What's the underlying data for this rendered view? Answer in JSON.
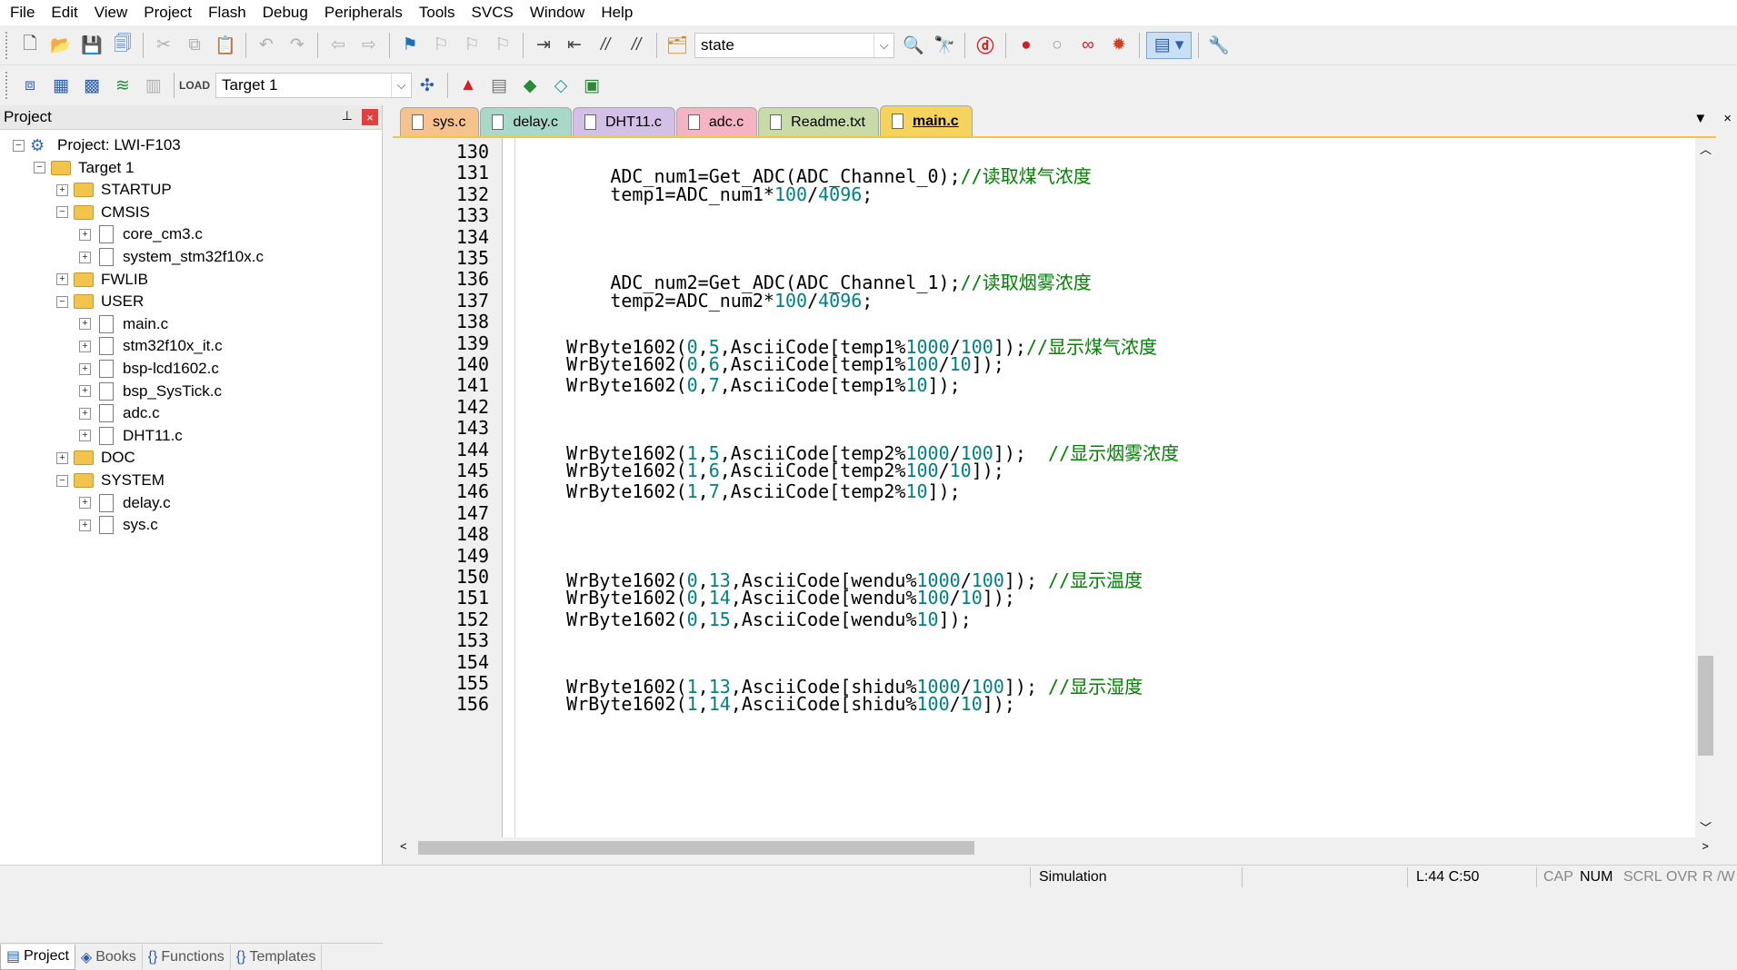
{
  "menu": [
    "File",
    "Edit",
    "View",
    "Project",
    "Flash",
    "Debug",
    "Peripherals",
    "Tools",
    "SVCS",
    "Window",
    "Help"
  ],
  "toolbar": {
    "find_value": "state",
    "target_value": "Target 1"
  },
  "project_panel": {
    "title": "Project",
    "pin": "⊥",
    "close": "×",
    "tree": [
      {
        "label": "Project: LWI-F103",
        "level": 0,
        "kind": "project",
        "expand": "−"
      },
      {
        "label": "Target 1",
        "level": 1,
        "kind": "target",
        "expand": "−"
      },
      {
        "label": "STARTUP",
        "level": 2,
        "kind": "folder",
        "expand": "+"
      },
      {
        "label": "CMSIS",
        "level": 2,
        "kind": "folder",
        "expand": "−"
      },
      {
        "label": "core_cm3.c",
        "level": 3,
        "kind": "file",
        "expand": "+"
      },
      {
        "label": "system_stm32f10x.c",
        "level": 3,
        "kind": "file",
        "expand": "+"
      },
      {
        "label": "FWLIB",
        "level": 2,
        "kind": "folder",
        "expand": "+"
      },
      {
        "label": "USER",
        "level": 2,
        "kind": "folder",
        "expand": "−"
      },
      {
        "label": "main.c",
        "level": 3,
        "kind": "file",
        "expand": "+"
      },
      {
        "label": "stm32f10x_it.c",
        "level": 3,
        "kind": "file",
        "expand": "+"
      },
      {
        "label": "bsp-lcd1602.c",
        "level": 3,
        "kind": "file",
        "expand": "+"
      },
      {
        "label": "bsp_SysTick.c",
        "level": 3,
        "kind": "file",
        "expand": "+"
      },
      {
        "label": "adc.c",
        "level": 3,
        "kind": "file",
        "expand": "+"
      },
      {
        "label": "DHT11.c",
        "level": 3,
        "kind": "file",
        "expand": "+"
      },
      {
        "label": "DOC",
        "level": 2,
        "kind": "folder",
        "expand": "+"
      },
      {
        "label": "SYSTEM",
        "level": 2,
        "kind": "folder",
        "expand": "−"
      },
      {
        "label": "delay.c",
        "level": 3,
        "kind": "file",
        "expand": "+"
      },
      {
        "label": "sys.c",
        "level": 3,
        "kind": "file",
        "expand": "+"
      }
    ],
    "tabs": [
      "Project",
      "Books",
      "Functions",
      "Templates"
    ],
    "tab_icons": [
      "▤",
      "◈",
      "{}",
      "{}"
    ]
  },
  "file_tabs": [
    {
      "label": "sys.c",
      "color": "#f6c28e"
    },
    {
      "label": "delay.c",
      "color": "#a8d8c8"
    },
    {
      "label": "DHT11.c",
      "color": "#d4bfe6"
    },
    {
      "label": "adc.c",
      "color": "#f4b4c4"
    },
    {
      "label": "Readme.txt",
      "color": "#c8dcaa"
    },
    {
      "label": "main.c",
      "color": "#f5d35e",
      "active": true
    }
  ],
  "tab_controls": {
    "menu": "▼",
    "close": "×"
  },
  "code": [
    {
      "ln": "130",
      "text": []
    },
    {
      "ln": "131",
      "text": [
        [
          "        ADC_num1=Get_ADC(ADC_Channel_0);",
          ""
        ],
        [
          "//读取煤气浓度",
          "c"
        ]
      ]
    },
    {
      "ln": "132",
      "text": [
        [
          "        temp1=ADC_num1*",
          ""
        ],
        [
          "100",
          "n"
        ],
        [
          "/",
          ""
        ],
        [
          "4096",
          "n"
        ],
        [
          ";",
          ""
        ]
      ]
    },
    {
      "ln": "133",
      "text": []
    },
    {
      "ln": "134",
      "text": []
    },
    {
      "ln": "135",
      "text": []
    },
    {
      "ln": "136",
      "text": [
        [
          "        ADC_num2=Get_ADC(ADC_Channel_1);",
          ""
        ],
        [
          "//读取烟雾浓度",
          "c"
        ]
      ]
    },
    {
      "ln": "137",
      "text": [
        [
          "        temp2=ADC_num2*",
          ""
        ],
        [
          "100",
          "n"
        ],
        [
          "/",
          ""
        ],
        [
          "4096",
          "n"
        ],
        [
          ";",
          ""
        ]
      ]
    },
    {
      "ln": "138",
      "text": []
    },
    {
      "ln": "139",
      "text": [
        [
          "    WrByte1602(",
          ""
        ],
        [
          "0",
          "n"
        ],
        [
          ",",
          ""
        ],
        [
          "5",
          "n"
        ],
        [
          ",AsciiCode[temp1%",
          ""
        ],
        [
          "1000",
          "n"
        ],
        [
          "/",
          ""
        ],
        [
          "100",
          "n"
        ],
        [
          "]);",
          ""
        ],
        [
          "//显示煤气浓度",
          "c"
        ]
      ]
    },
    {
      "ln": "140",
      "text": [
        [
          "    WrByte1602(",
          ""
        ],
        [
          "0",
          "n"
        ],
        [
          ",",
          ""
        ],
        [
          "6",
          "n"
        ],
        [
          ",AsciiCode[temp1%",
          ""
        ],
        [
          "100",
          "n"
        ],
        [
          "/",
          ""
        ],
        [
          "10",
          "n"
        ],
        [
          "]);",
          ""
        ]
      ]
    },
    {
      "ln": "141",
      "text": [
        [
          "    WrByte1602(",
          ""
        ],
        [
          "0",
          "n"
        ],
        [
          ",",
          ""
        ],
        [
          "7",
          "n"
        ],
        [
          ",AsciiCode[temp1%",
          ""
        ],
        [
          "10",
          "n"
        ],
        [
          "]);",
          ""
        ]
      ]
    },
    {
      "ln": "142",
      "text": []
    },
    {
      "ln": "143",
      "text": []
    },
    {
      "ln": "144",
      "text": [
        [
          "    WrByte1602(",
          ""
        ],
        [
          "1",
          "n"
        ],
        [
          ",",
          ""
        ],
        [
          "5",
          "n"
        ],
        [
          ",AsciiCode[temp2%",
          ""
        ],
        [
          "1000",
          "n"
        ],
        [
          "/",
          ""
        ],
        [
          "100",
          "n"
        ],
        [
          "]);  ",
          ""
        ],
        [
          "//显示烟雾浓度",
          "c"
        ]
      ]
    },
    {
      "ln": "145",
      "text": [
        [
          "    WrByte1602(",
          ""
        ],
        [
          "1",
          "n"
        ],
        [
          ",",
          ""
        ],
        [
          "6",
          "n"
        ],
        [
          ",AsciiCode[temp2%",
          ""
        ],
        [
          "100",
          "n"
        ],
        [
          "/",
          ""
        ],
        [
          "10",
          "n"
        ],
        [
          "]);",
          ""
        ]
      ]
    },
    {
      "ln": "146",
      "text": [
        [
          "    WrByte1602(",
          ""
        ],
        [
          "1",
          "n"
        ],
        [
          ",",
          ""
        ],
        [
          "7",
          "n"
        ],
        [
          ",AsciiCode[temp2%",
          ""
        ],
        [
          "10",
          "n"
        ],
        [
          "]);",
          ""
        ]
      ]
    },
    {
      "ln": "147",
      "text": []
    },
    {
      "ln": "148",
      "text": []
    },
    {
      "ln": "149",
      "text": []
    },
    {
      "ln": "150",
      "text": [
        [
          "    WrByte1602(",
          ""
        ],
        [
          "0",
          "n"
        ],
        [
          ",",
          ""
        ],
        [
          "13",
          "n"
        ],
        [
          ",AsciiCode[wendu%",
          ""
        ],
        [
          "1000",
          "n"
        ],
        [
          "/",
          ""
        ],
        [
          "100",
          "n"
        ],
        [
          "]); ",
          ""
        ],
        [
          "//显示温度",
          "c"
        ]
      ]
    },
    {
      "ln": "151",
      "text": [
        [
          "    WrByte1602(",
          ""
        ],
        [
          "0",
          "n"
        ],
        [
          ",",
          ""
        ],
        [
          "14",
          "n"
        ],
        [
          ",AsciiCode[wendu%",
          ""
        ],
        [
          "100",
          "n"
        ],
        [
          "/",
          ""
        ],
        [
          "10",
          "n"
        ],
        [
          "]);",
          ""
        ]
      ]
    },
    {
      "ln": "152",
      "text": [
        [
          "    WrByte1602(",
          ""
        ],
        [
          "0",
          "n"
        ],
        [
          ",",
          ""
        ],
        [
          "15",
          "n"
        ],
        [
          ",AsciiCode[wendu%",
          ""
        ],
        [
          "10",
          "n"
        ],
        [
          "]);",
          ""
        ]
      ]
    },
    {
      "ln": "153",
      "text": []
    },
    {
      "ln": "154",
      "text": []
    },
    {
      "ln": "155",
      "text": [
        [
          "    WrByte1602(",
          ""
        ],
        [
          "1",
          "n"
        ],
        [
          ",",
          ""
        ],
        [
          "13",
          "n"
        ],
        [
          ",AsciiCode[shidu%",
          ""
        ],
        [
          "1000",
          "n"
        ],
        [
          "/",
          ""
        ],
        [
          "100",
          "n"
        ],
        [
          "]); ",
          ""
        ],
        [
          "//显示湿度",
          "c"
        ]
      ]
    },
    {
      "ln": "156",
      "text": [
        [
          "    WrByte1602(",
          ""
        ],
        [
          "1",
          "n"
        ],
        [
          ",",
          ""
        ],
        [
          "14",
          "n"
        ],
        [
          ",AsciiCode[shidu%",
          ""
        ],
        [
          "100",
          "n"
        ],
        [
          "/",
          ""
        ],
        [
          "10",
          "n"
        ],
        [
          "]);",
          ""
        ]
      ]
    }
  ],
  "status": {
    "mode": "Simulation",
    "position": "L:44 C:50",
    "cap": "CAP",
    "num": "NUM",
    "scrl": "SCRL",
    "ovr": "OVR",
    "rw": "R /W"
  }
}
